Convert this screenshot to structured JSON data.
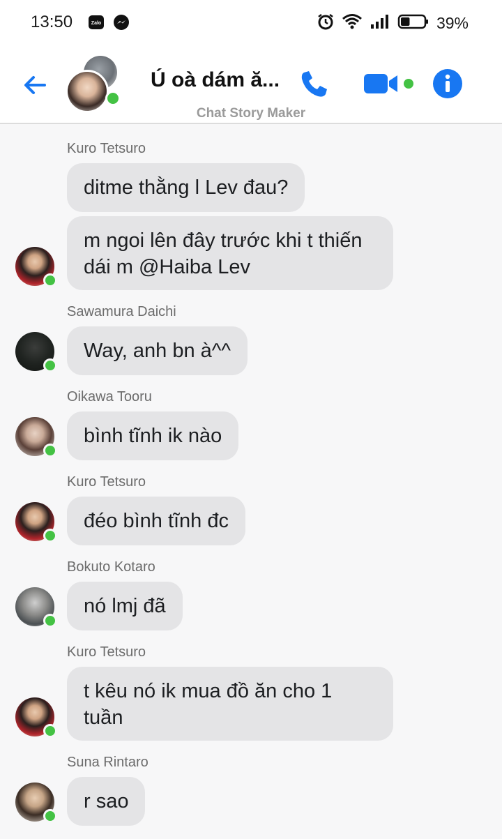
{
  "status_bar": {
    "time": "13:50",
    "app_icons": [
      "zalo-icon",
      "messenger-icon"
    ],
    "status_icons": [
      "alarm-icon",
      "wifi-icon",
      "signal-icon",
      "battery-icon"
    ],
    "battery_percent": "39%",
    "battery_level": 0.39
  },
  "header": {
    "title": "Ú oà dám ă...",
    "subtitle": "Chat Story Maker",
    "accent_color": "#1877f2",
    "online_color": "#44c244"
  },
  "messages": [
    {
      "sender": "Kuro Tetsuro",
      "avatar": "kuro",
      "bubbles": [
        "ditme thằng l Lev đau?",
        "m ngoi lên đây trước khi t thiến dái m @Haiba Lev"
      ]
    },
    {
      "sender": "Sawamura Daichi",
      "avatar": "daichi",
      "bubbles": [
        "Way, anh bn à^^"
      ]
    },
    {
      "sender": "Oikawa Tooru",
      "avatar": "oikawa",
      "bubbles": [
        "bình tĩnh ik nào"
      ]
    },
    {
      "sender": "Kuro Tetsuro",
      "avatar": "kuro",
      "bubbles": [
        "đéo bình tĩnh đc"
      ]
    },
    {
      "sender": "Bokuto Kotaro",
      "avatar": "bokuto",
      "bubbles": [
        "nó lmj đã"
      ]
    },
    {
      "sender": "Kuro Tetsuro",
      "avatar": "kuro",
      "bubbles": [
        "t kêu nó ik mua đồ ăn cho 1 tuần"
      ]
    },
    {
      "sender": "Suna Rintaro",
      "avatar": "suna",
      "bubbles": [
        "r sao"
      ]
    }
  ]
}
